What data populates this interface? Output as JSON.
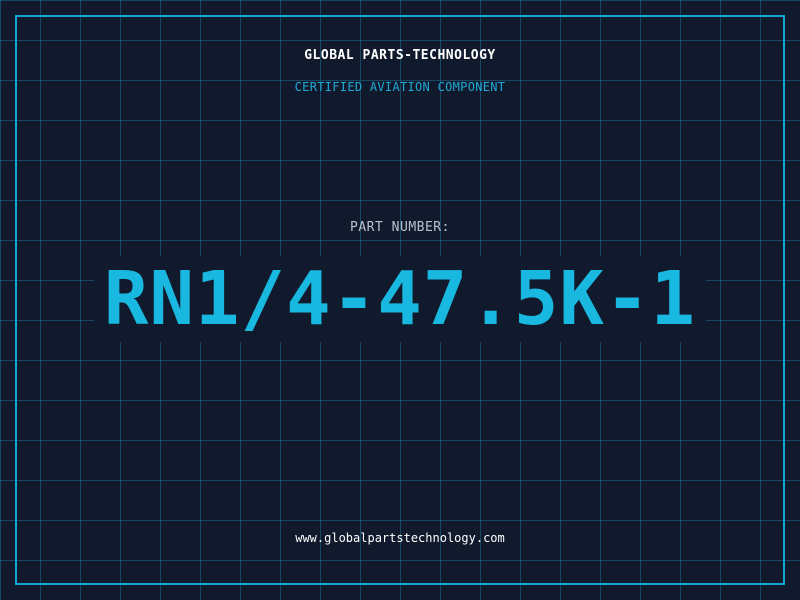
{
  "header": {
    "company": "GLOBAL PARTS-TECHNOLOGY",
    "tagline": "CERTIFIED AVIATION COMPONENT"
  },
  "part": {
    "label": "PART NUMBER:",
    "number": "RN1/4-47.5K-1"
  },
  "footer": {
    "website": "www.globalpartstechnology.com"
  },
  "colors": {
    "background": "#111a2c",
    "grid": "#1e6e8c",
    "accent": "#19b8e0",
    "frame": "#14a8d2",
    "text_primary": "#ffffff",
    "text_muted": "#b9c2cc"
  }
}
